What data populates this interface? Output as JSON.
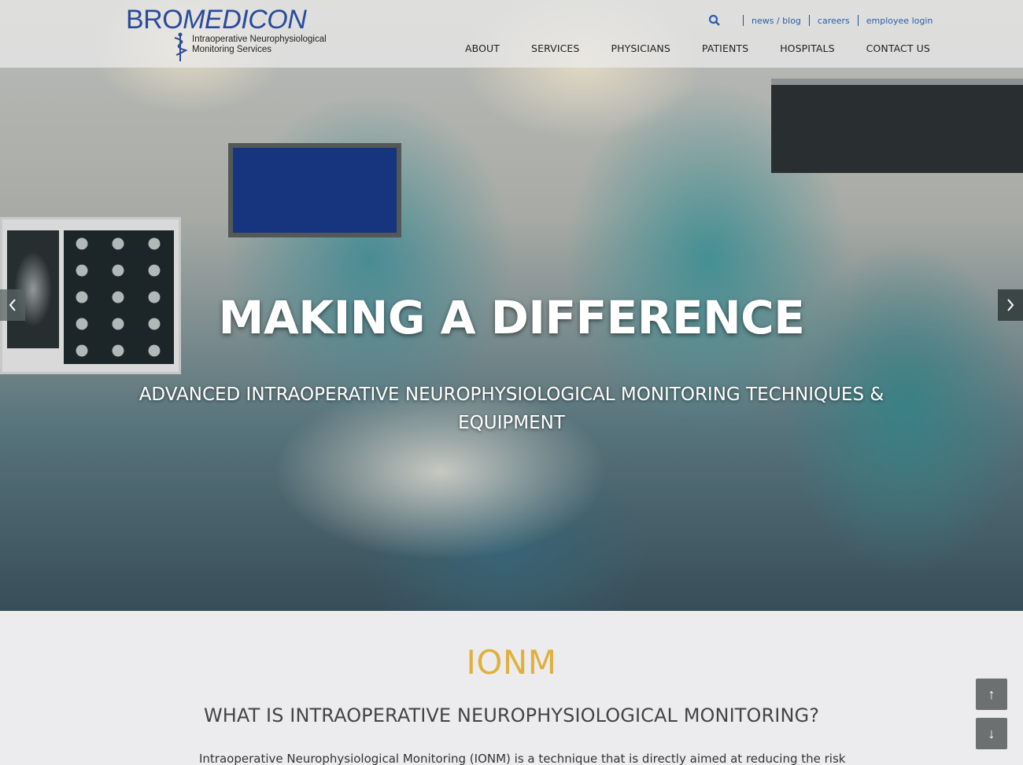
{
  "logo": {
    "brand_part1": "BRO",
    "brand_part2": "MEDICON",
    "tagline_line1": "Intraoperative Neurophysiological",
    "tagline_line2": "Monitoring Services"
  },
  "utility_nav": {
    "search_icon": "search-icon",
    "links": [
      "news / blog",
      "careers",
      "employee login"
    ]
  },
  "main_nav": {
    "items": [
      "ABOUT",
      "SERVICES",
      "PHYSICIANS",
      "PATIENTS",
      "HOSPITALS",
      "CONTACT US"
    ]
  },
  "hero": {
    "title": "MAKING A DIFFERENCE",
    "subtitle": "ADVANCED INTRAOPERATIVE NEUROPHYSIOLOGICAL MONITORING TECHNIQUES & EQUIPMENT",
    "prev_icon": "chevron-left-icon",
    "next_icon": "chevron-right-icon"
  },
  "section": {
    "title": "IONM",
    "heading": "WHAT IS INTRAOPERATIVE NEUROPHYSIOLOGICAL MONITORING?",
    "body": "Intraoperative Neurophysiological Monitoring (IONM) is a technique that is directly aimed at reducing the risk"
  },
  "scroll": {
    "up": "↑",
    "down": "↓"
  },
  "colors": {
    "brand_blue": "#2a4b9b",
    "accent_gold": "#e0b03a",
    "link_blue": "#2a5fa8"
  }
}
